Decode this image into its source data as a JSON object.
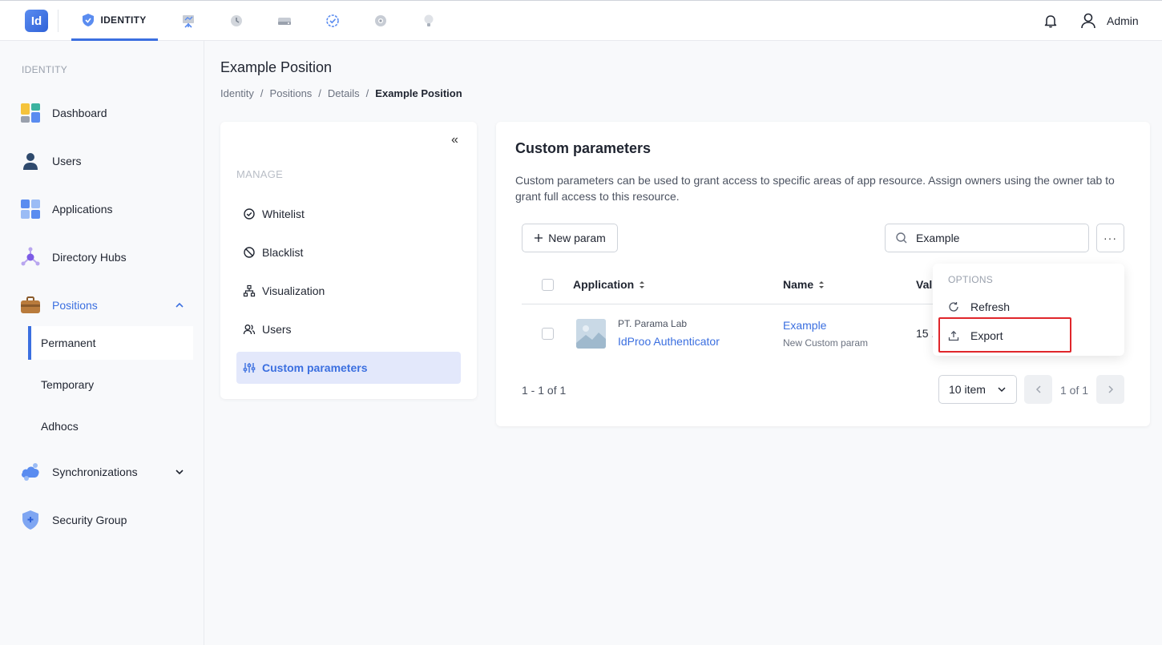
{
  "topbar": {
    "logo_text": "Id",
    "active_module": "IDENTITY",
    "other_modules": [
      "presentation-icon",
      "history-icon",
      "storage-icon",
      "clock-check-icon",
      "settings-icon",
      "bulb-icon"
    ],
    "user_name": "Admin"
  },
  "sidebar": {
    "section": "IDENTITY",
    "items": {
      "dashboard": "Dashboard",
      "users": "Users",
      "applications": "Applications",
      "directory_hubs": "Directory Hubs",
      "positions": "Positions",
      "synchronizations": "Synchronizations",
      "security_group": "Security Group"
    },
    "positions_sub": {
      "permanent": "Permanent",
      "temporary": "Temporary",
      "adhocs": "Adhocs"
    }
  },
  "header": {
    "title": "Example Position",
    "breadcrumb": [
      "Identity",
      "Positions",
      "Details",
      "Example Position"
    ],
    "separator": "/"
  },
  "manage": {
    "collapse": "«",
    "label": "MANAGE",
    "items": {
      "whitelist": "Whitelist",
      "blacklist": "Blacklist",
      "visualization": "Visualization",
      "users": "Users",
      "custom_parameters": "Custom parameters"
    }
  },
  "content": {
    "title": "Custom parameters",
    "description": "Custom parameters can be used to grant access to specific areas of app resource. Assign owners using the owner tab to grant full access to this resource.",
    "new_button": "New param",
    "search_value": "Example",
    "more_button": "···",
    "columns": {
      "application": "Application",
      "name": "Name",
      "value": "Val"
    },
    "rows": [
      {
        "app_org": "PT. Parama Lab",
        "app_name": "IdProo Authenticator",
        "param_name": "Example",
        "param_sub": "New Custom param",
        "value": "15 ."
      }
    ],
    "range": "1 - 1 of 1",
    "per_page": "10 item",
    "page_text": "1 of 1"
  },
  "options_menu": {
    "label": "OPTIONS",
    "refresh": "Refresh",
    "export": "Export"
  },
  "colors": {
    "accent": "#3b6fe0",
    "highlight": "#e0262b",
    "active_bg": "#e3e8fb"
  }
}
